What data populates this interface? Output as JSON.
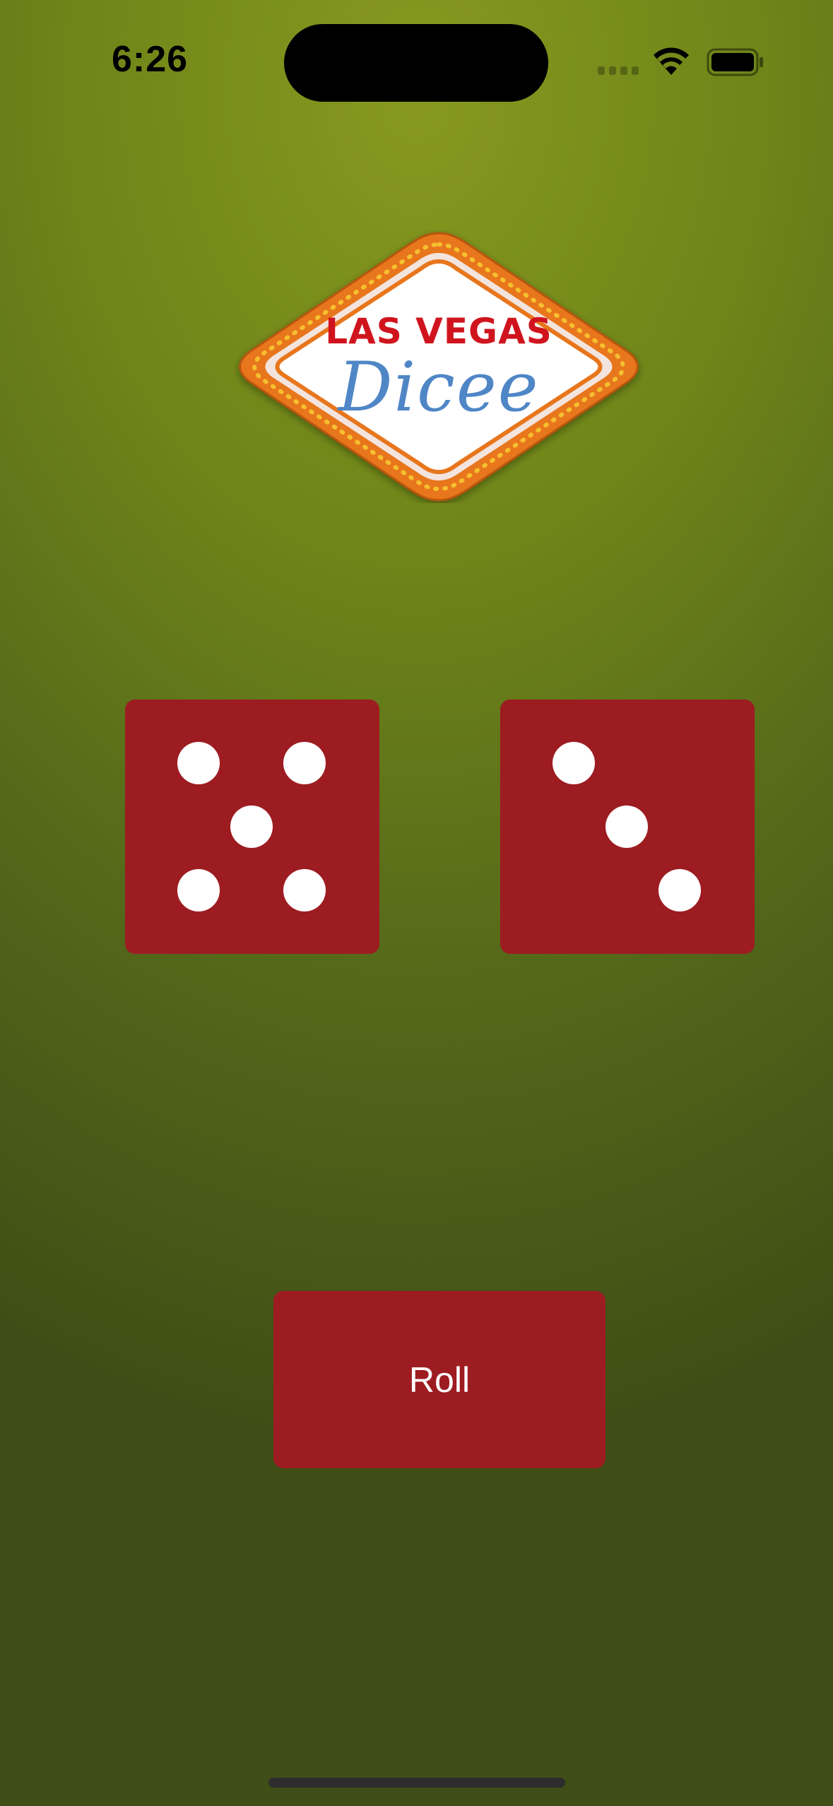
{
  "status_bar": {
    "time": "6:26",
    "icons": [
      "signal-dots-icon",
      "wifi-icon",
      "battery-icon"
    ]
  },
  "logo": {
    "line1": "LAS VEGAS",
    "line2": "Dicee",
    "colors": {
      "frame": "#e8761c",
      "bulbs": "#f5c030",
      "text_red": "#d0141e",
      "text_blue": "#4f86c6"
    }
  },
  "dice": [
    {
      "name": "left-die",
      "value": 5
    },
    {
      "name": "right-die",
      "value": 3
    }
  ],
  "roll_button": {
    "label": "Roll"
  },
  "colors": {
    "felt": "#6f8419",
    "die": "#9d1c21",
    "button": "#9d1c21"
  }
}
